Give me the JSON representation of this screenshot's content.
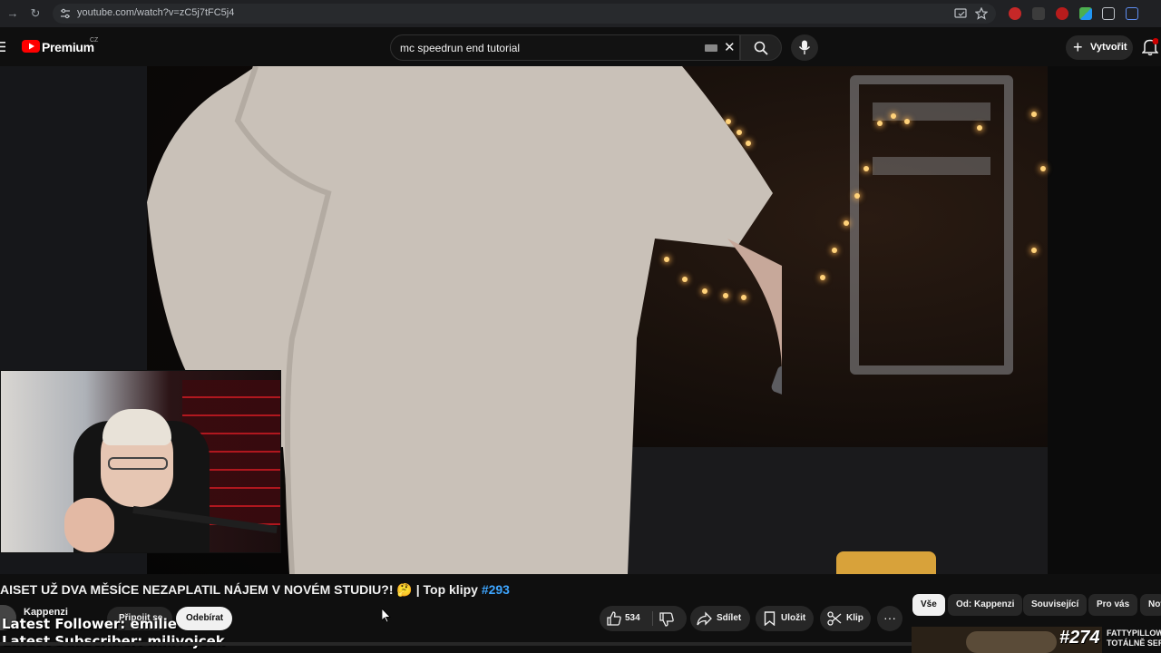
{
  "browser": {
    "url": "youtube.com/watch?v=zC5j7tFC5j4",
    "icons": [
      "back-icon",
      "forward-icon",
      "reload-icon",
      "site-info-icon",
      "cast-icon",
      "bookmark-star-icon",
      "extensions-icon"
    ]
  },
  "header": {
    "logo_text": "Premium",
    "country_code": "CZ",
    "search_value": "mc speedrun end tutorial",
    "create_label": "Vytvořit",
    "notifications_badge": "9"
  },
  "video": {
    "title_main": "AISET UŽ DVA MĚSÍCE NEZAPLATIL NÁJEM V NOVÉM STUDIU?! 🤔 | Top klipy ",
    "title_tag": "#293",
    "channel_name": "Kappenzi",
    "join_label": "Připojit se",
    "unsubscribe_label": "Odebírat",
    "like_count": "534",
    "share_label": "Sdílet",
    "save_label": "Uložit",
    "clip_label": "Klip",
    "more_label": "···"
  },
  "stream_overlay": {
    "latest_follower": "Latest Follower: emilie",
    "latest_subscriber": "Latest Subscriber: milivojcek"
  },
  "chips": [
    "Vše",
    "Od: Kappenzi",
    "Související",
    "Pro vás",
    "Nov"
  ],
  "recommendation": {
    "episode_number": "#274",
    "title_line1": "FATTYPILLOW",
    "title_line2": "TOTÁLNĚ SEP"
  },
  "colors": {
    "background": "#0f0f0f",
    "youtube_red": "#ff0000",
    "hashtag_blue": "#3ea6ff",
    "button_gray": "#272727"
  }
}
